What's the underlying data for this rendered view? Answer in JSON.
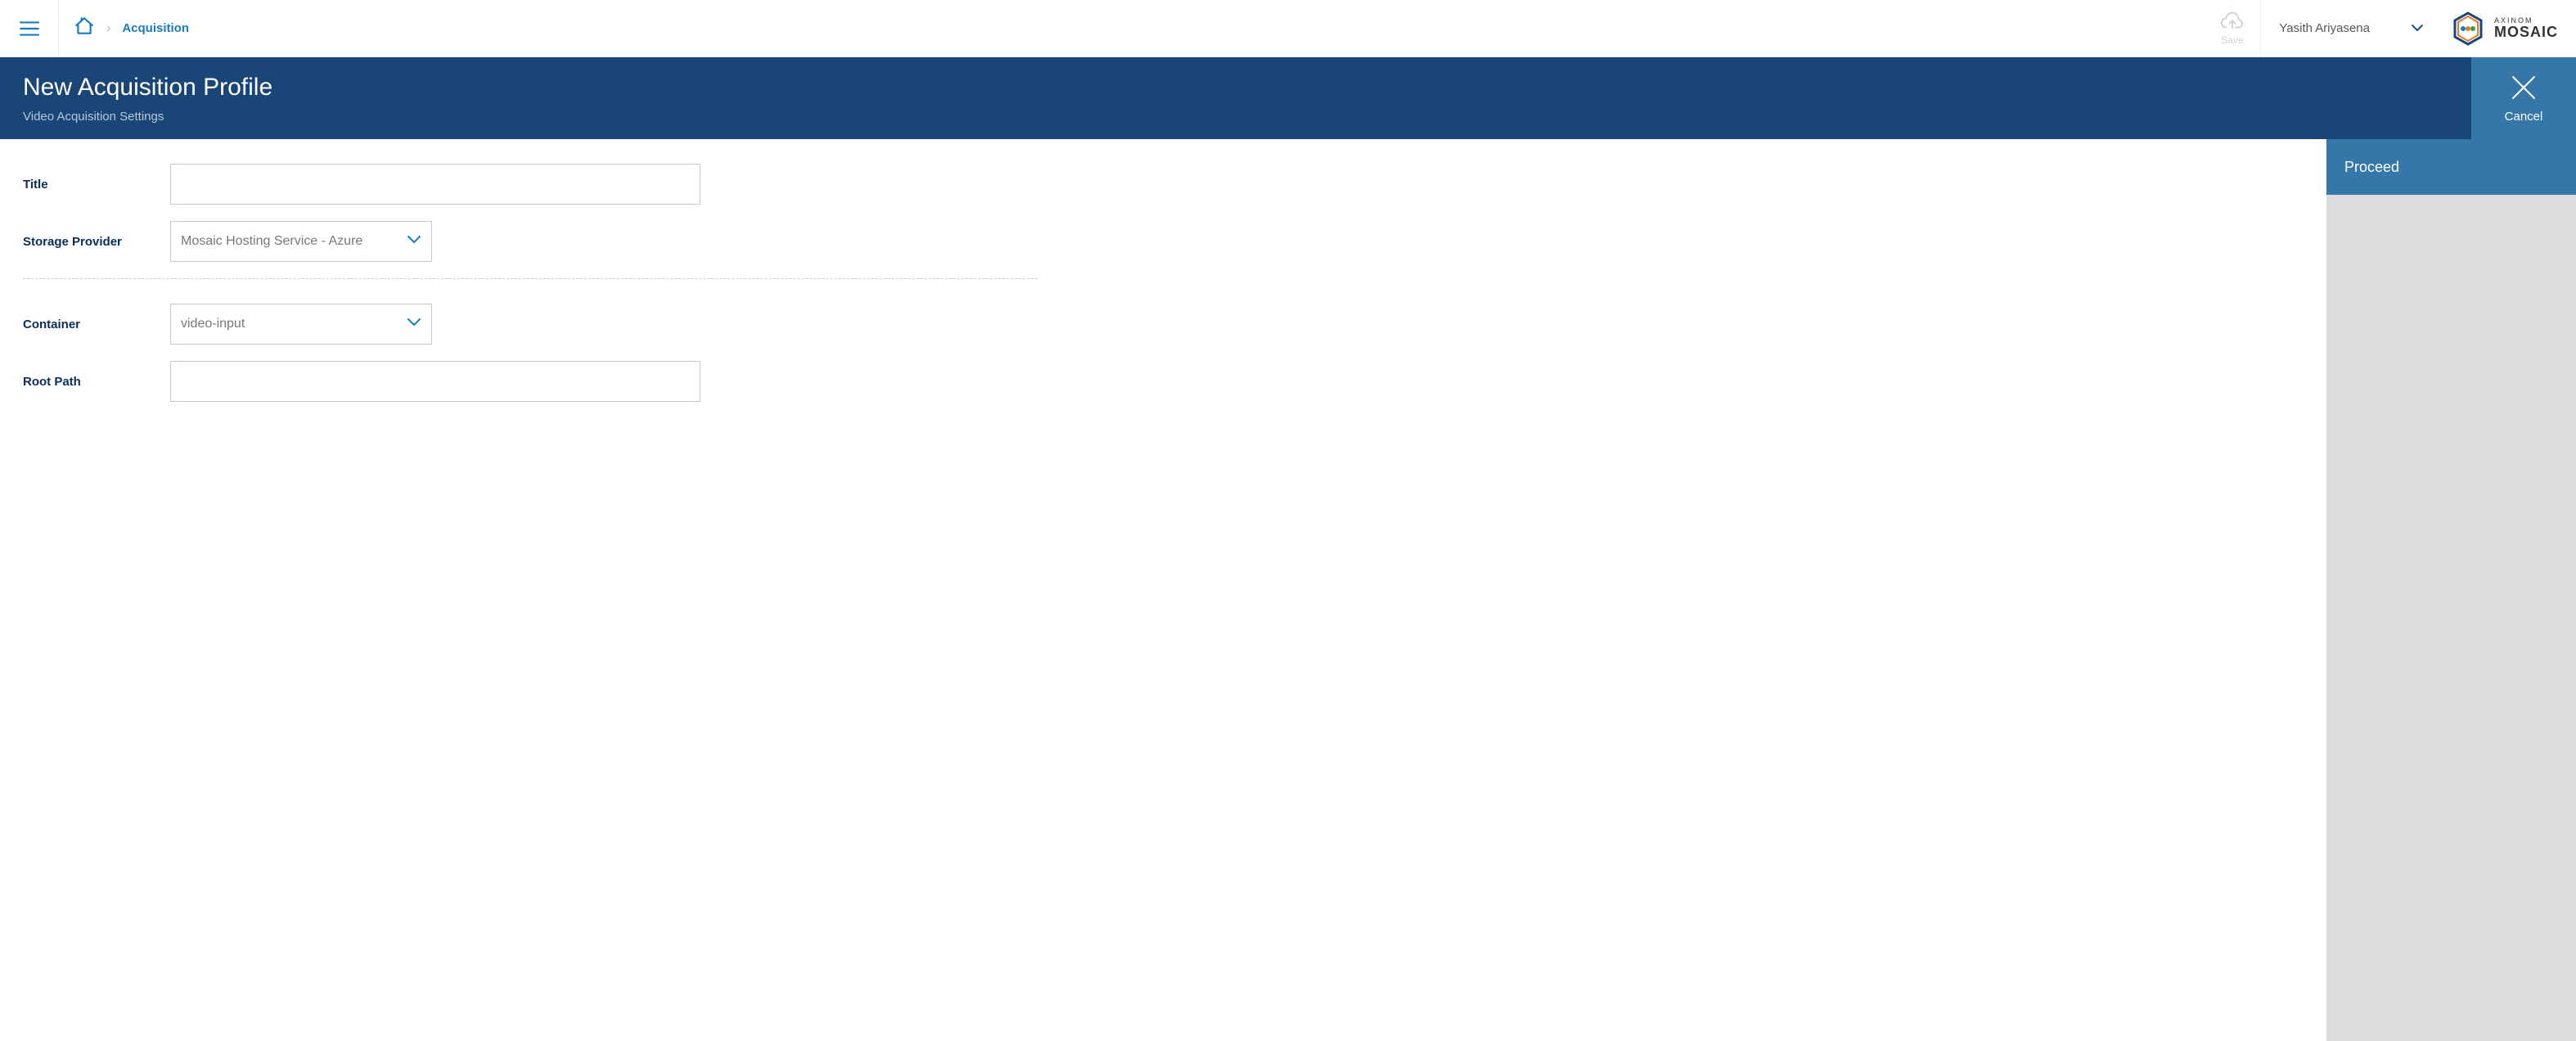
{
  "topbar": {
    "breadcrumb": {
      "crumb": "Acquisition"
    },
    "save_label": "Save",
    "user_name": "Yasith Ariyasena",
    "logo": {
      "brand_sub": "AXINOM",
      "brand_main": "MOSAIC"
    }
  },
  "header": {
    "title": "New Acquisition Profile",
    "subtitle": "Video Acquisition Settings",
    "cancel_label": "Cancel"
  },
  "form": {
    "labels": {
      "title": "Title",
      "storage_provider": "Storage Provider",
      "container": "Container",
      "root_path": "Root Path"
    },
    "values": {
      "title": "",
      "storage_provider": "Mosaic Hosting Service - Azure",
      "container": "video-input",
      "root_path": ""
    }
  },
  "sidepanel": {
    "proceed_label": "Proceed"
  }
}
